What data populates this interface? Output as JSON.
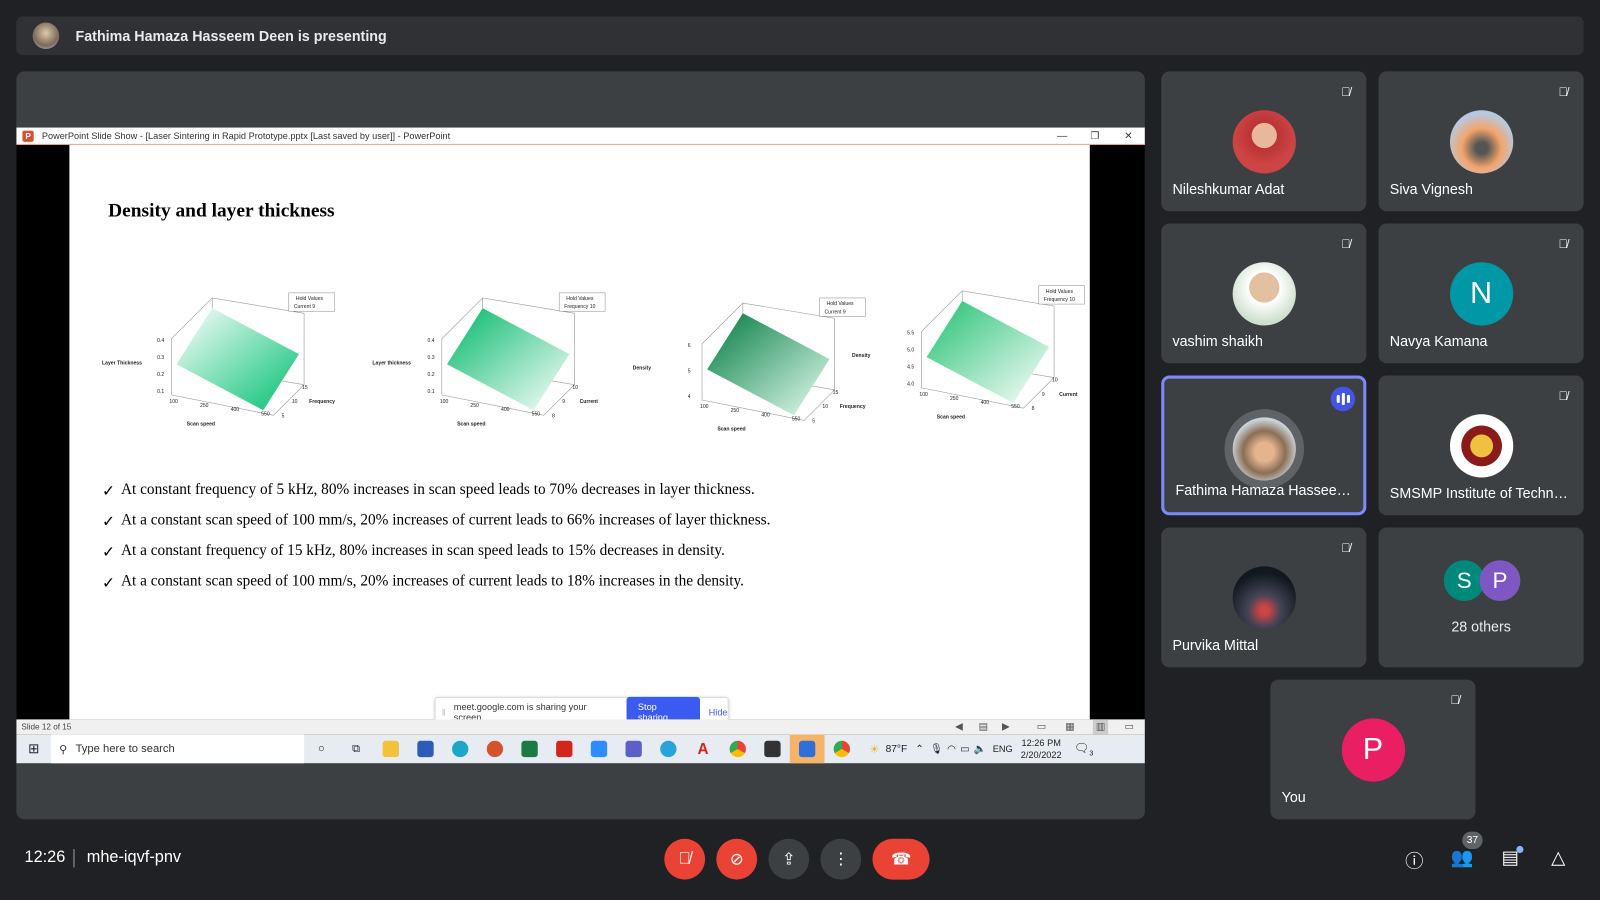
{
  "presenter_bar": {
    "text": "Fathima Hamaza Hasseem Deen is presenting"
  },
  "ppt": {
    "title": "PowerPoint Slide Show - [Laser Sintering in Rapid Prototype.pptx [Last saved by user]] - PowerPoint",
    "status": "Slide 12 of 15"
  },
  "slide": {
    "title": "Density and layer thickness",
    "charts": [
      {
        "ylabel": "Layer Thickness",
        "xlabel": "Scan speed",
        "zlabel": "Frequency",
        "hold1": "Hold Values",
        "hold2": "Current  9",
        "yticks": [
          "0.4",
          "0.3",
          "0.2",
          "0.1"
        ],
        "xticks": [
          "100",
          "250",
          "400",
          "550"
        ],
        "zticks": [
          "5",
          "10",
          "15"
        ]
      },
      {
        "ylabel": "Layer thickness",
        "xlabel": "Scan speed",
        "zlabel": "Current",
        "hold1": "Hold Values",
        "hold2": "Frequency  10",
        "yticks": [
          "0.4",
          "0.3",
          "0.2",
          "0.1"
        ],
        "xticks": [
          "100",
          "250",
          "400",
          "550"
        ],
        "zticks": [
          "8",
          "9",
          "10"
        ]
      },
      {
        "ylabel": "Density",
        "xlabel": "Scan speed",
        "zlabel": "Frequency",
        "hold1": "Hold Values",
        "hold2": "Current  9",
        "yticks": [
          "6",
          "5",
          "4"
        ],
        "xticks": [
          "100",
          "250",
          "400",
          "550"
        ],
        "zticks": [
          "5",
          "10",
          "15"
        ]
      },
      {
        "ylabel": "Density",
        "xlabel": "Scan speed",
        "zlabel": "Current",
        "hold1": "Hold Values",
        "hold2": "Frequency  10",
        "yticks": [
          "5.5",
          "5.0",
          "4.5",
          "4.0"
        ],
        "xticks": [
          "100",
          "250",
          "400",
          "550"
        ],
        "zticks": [
          "8",
          "9",
          "10"
        ]
      }
    ],
    "check": "✓",
    "bullets": [
      "At constant frequency of 5 kHz, 80% increases in scan speed leads to 70% decreases in layer thickness.",
      "At a constant scan speed of 100 mm/s, 20% increases of current leads to 66% increases of layer thickness.",
      "At a constant frequency of 15 kHz, 80% increases in scan speed leads to 15% decreases in density.",
      "At a constant scan speed of 100 mm/s, 20% increases of current leads to 18% increases in the density."
    ]
  },
  "share_banner": {
    "text": "meet.google.com is sharing your screen.",
    "stop": "Stop sharing",
    "hide": "Hide"
  },
  "taskbar": {
    "search_placeholder": "Type here to search",
    "weather": "87°F",
    "lang": "ENG",
    "time": "12:26 PM",
    "date": "2/20/2022",
    "notif": "3"
  },
  "participants": [
    {
      "name": "Nileshkumar Adat",
      "muted": true
    },
    {
      "name": "Siva Vignesh",
      "muted": true
    },
    {
      "name": "vashim shaikh",
      "muted": true
    },
    {
      "name": "Navya Kamana",
      "initial": "N",
      "color": "#0097a7",
      "muted": true
    },
    {
      "name": "Fathima Hamaza Hasseem Deen",
      "speaking": true
    },
    {
      "name": "SMSMP Institute of Technology",
      "muted": true
    },
    {
      "name": "Purvika Mittal",
      "muted": true
    },
    {
      "name": "28 others",
      "initials": [
        "S",
        "P"
      ],
      "colors": [
        "#00897b",
        "#7e57c2"
      ]
    },
    {
      "name": "You",
      "initial": "P",
      "color": "#e91e63",
      "muted": true
    }
  ],
  "bottom": {
    "time": "12:26",
    "code": "mhe-iqvf-pnv",
    "people_count": "37"
  },
  "colors": {
    "accent": "#8ab4f8",
    "danger": "#ea4335",
    "speaking": "#4455e6"
  }
}
